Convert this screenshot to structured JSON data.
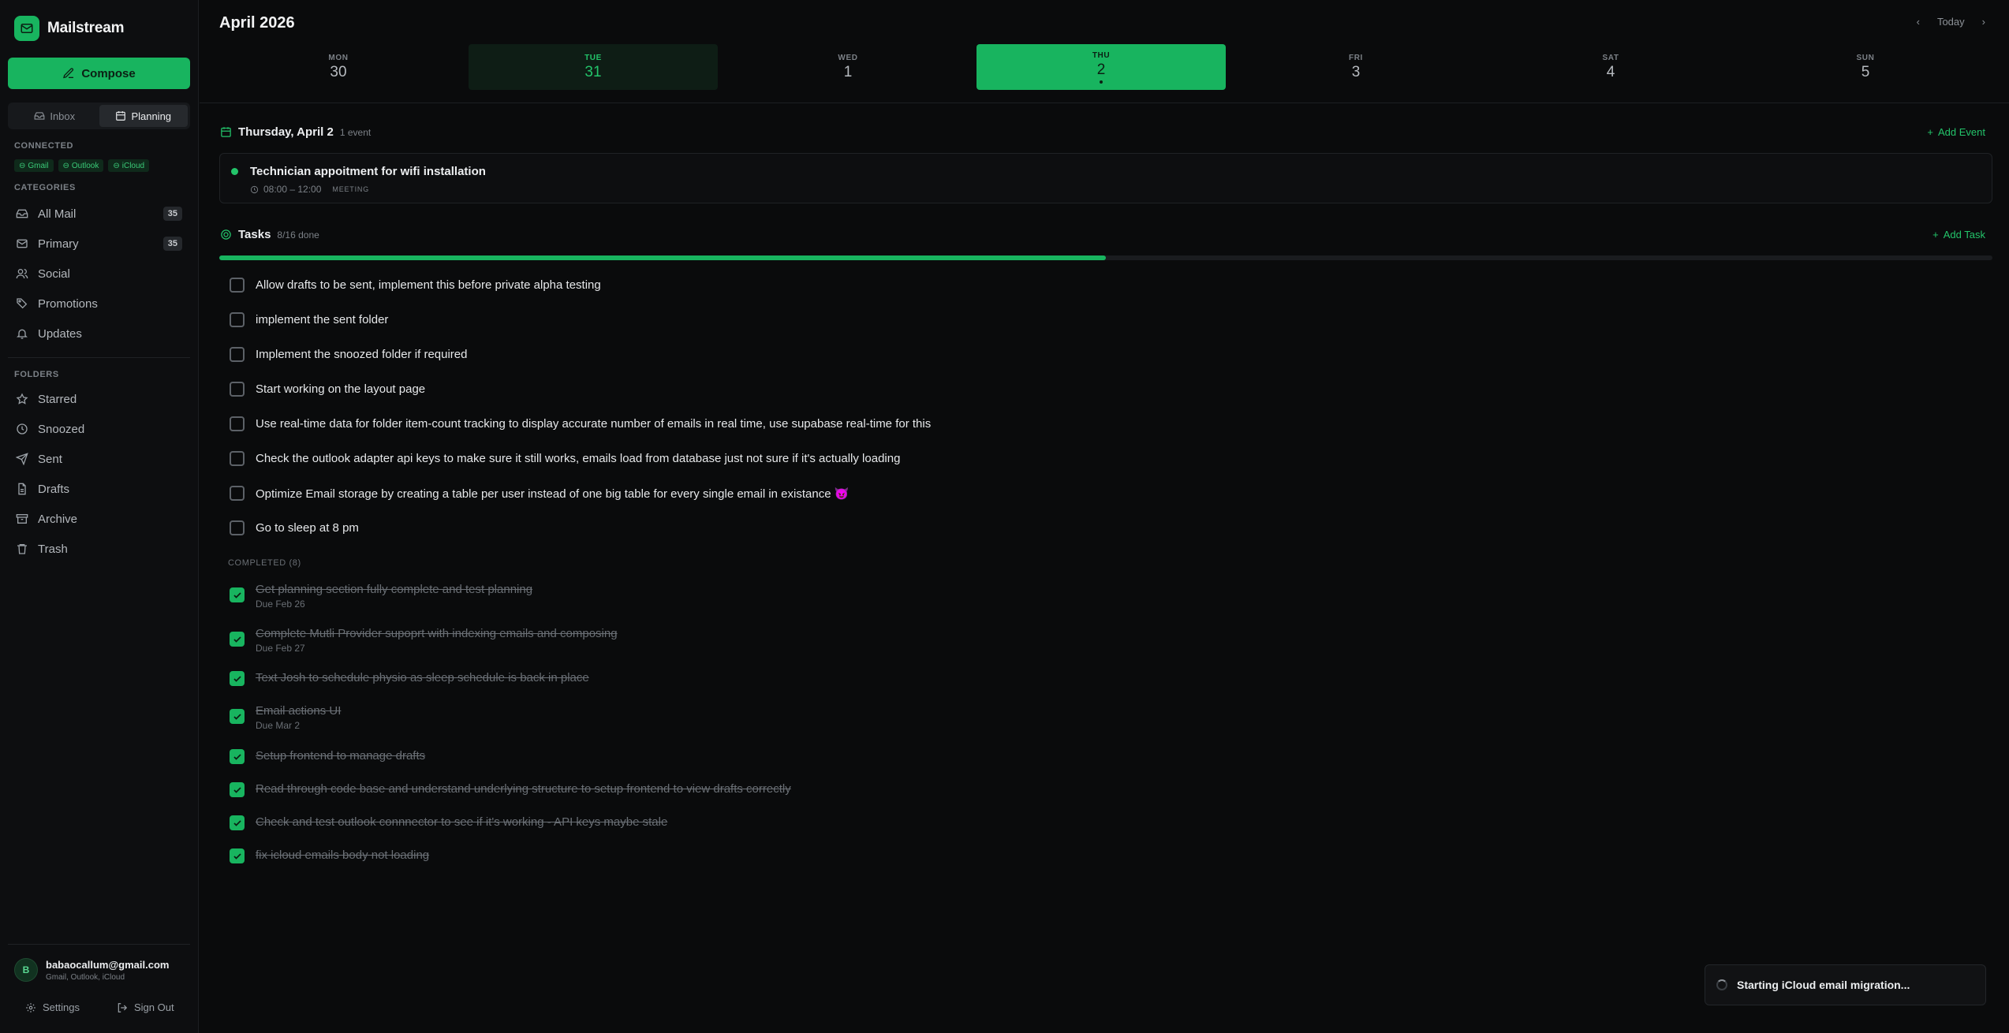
{
  "app": {
    "name": "Mailstream",
    "compose_label": "Compose"
  },
  "view_toggle": {
    "inbox_label": "Inbox",
    "planning_label": "Planning"
  },
  "connected": {
    "heading": "CONNECTED",
    "accounts": [
      "Gmail",
      "Outlook",
      "iCloud"
    ]
  },
  "categories": {
    "heading": "CATEGORIES",
    "items": [
      {
        "label": "All Mail",
        "count": "35"
      },
      {
        "label": "Primary",
        "count": "35"
      },
      {
        "label": "Social"
      },
      {
        "label": "Promotions"
      },
      {
        "label": "Updates"
      }
    ]
  },
  "folders": {
    "heading": "FOLDERS",
    "items": [
      {
        "label": "Starred"
      },
      {
        "label": "Snoozed"
      },
      {
        "label": "Sent"
      },
      {
        "label": "Drafts"
      },
      {
        "label": "Archive"
      },
      {
        "label": "Trash"
      }
    ]
  },
  "user": {
    "initial": "B",
    "email": "babaocallum@gmail.com",
    "providers": "Gmail, Outlook, iCloud"
  },
  "footer": {
    "settings_label": "Settings",
    "signout_label": "Sign Out"
  },
  "header": {
    "month_title": "April 2026",
    "today_label": "Today"
  },
  "week": [
    {
      "name": "MON",
      "num": "30"
    },
    {
      "name": "TUE",
      "num": "31"
    },
    {
      "name": "WED",
      "num": "1"
    },
    {
      "name": "THU",
      "num": "2"
    },
    {
      "name": "FRI",
      "num": "3"
    },
    {
      "name": "SAT",
      "num": "4"
    },
    {
      "name": "SUN",
      "num": "5"
    }
  ],
  "events_section": {
    "title": "Thursday, April 2",
    "count": "1 event",
    "add_label": "Add Event",
    "event": {
      "title": "Technician appoitment for wifi installation",
      "time": "08:00 – 12:00",
      "tag": "MEETING"
    }
  },
  "tasks_section": {
    "title": "Tasks",
    "progress_text": "8/16 done",
    "progress": 0.5,
    "add_label": "Add Task"
  },
  "open_tasks": [
    "Allow drafts to be sent, implement this before private alpha testing",
    "implement the sent folder",
    "Implement the snoozed folder if required",
    "Start working on the layout page",
    "Use real-time data for folder item-count tracking to display accurate number of emails in real time, use supabase real-time for this",
    "Check the outlook adapter api keys to make sure it still works, emails load from database just not sure if it's actually loading",
    "Optimize Email storage by creating a table per user instead of one big table for every single email in existance 😈",
    "Go to sleep at 8 pm"
  ],
  "completed": {
    "heading": "COMPLETED (8)",
    "items": [
      {
        "text": "Get planning section fully complete and test planning",
        "due": "Due Feb 26"
      },
      {
        "text": "Complete Mutli Provider supoprt with indexing emails and composing",
        "due": "Due Feb 27"
      },
      {
        "text": "Text Josh to schedule physio as sleep schedule is back in place"
      },
      {
        "text": "Email actions UI",
        "due": "Due Mar 2"
      },
      {
        "text": "Setup frontend to manage drafts"
      },
      {
        "text": "Read through code base and understand underlying structure to setup frontend to view drafts correctly"
      },
      {
        "text": "Check and test outlook connnector to see if it's working - API keys maybe stale"
      },
      {
        "text": "fix icloud emails body not loading"
      }
    ]
  },
  "toast": {
    "text": "Starting iCloud email migration..."
  },
  "colors": {
    "accent": "#18b45f",
    "background": "#0a0b0c",
    "sidebar": "#0d0e10"
  }
}
